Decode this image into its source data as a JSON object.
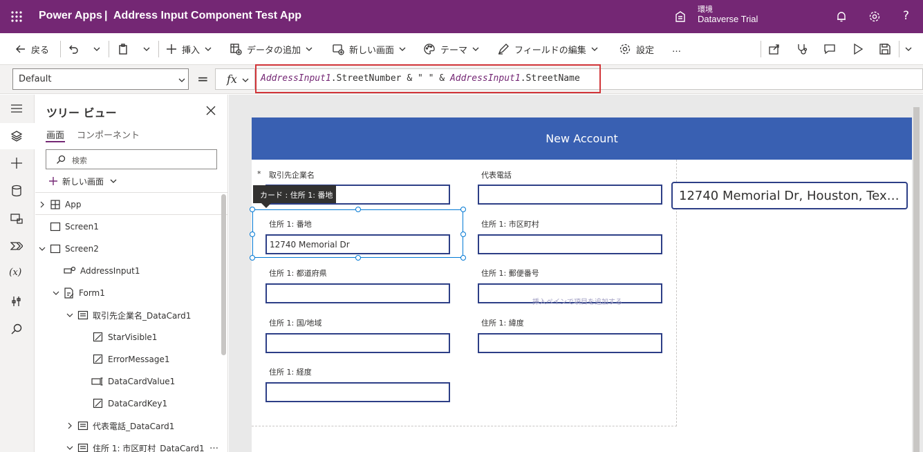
{
  "app": {
    "brand": "Power Apps",
    "separator": "|",
    "title": "Address Input Component Test App",
    "environment_label": "環境",
    "environment_name": "Dataverse Trial",
    "help": "?"
  },
  "commands": {
    "back": "戻る",
    "insert": "挿入",
    "add_data": "データの追加",
    "new_screen": "新しい画面",
    "theme": "テーマ",
    "edit_fields": "フィールドの編集",
    "settings": "設定",
    "more": "…"
  },
  "formula_bar": {
    "property": "Default",
    "equals": "=",
    "fx": "fx",
    "formula_ctl1": "AddressInput1",
    "formula_part1": ".StreetNumber & \" \" & ",
    "formula_ctl2": "AddressInput1",
    "formula_part2": ".StreetName"
  },
  "tree_view": {
    "title": "ツリー ビュー",
    "tabs": [
      "画面",
      "コンポーネント"
    ],
    "search_placeholder": "検索",
    "new_screen": "新しい画面",
    "nodes": [
      {
        "label": "App",
        "icon": "app-icon"
      },
      {
        "label": "Screen1",
        "icon": "screen-icon"
      },
      {
        "label": "Screen2",
        "icon": "screen-icon"
      },
      {
        "label": "AddressInput1",
        "icon": "component-icon"
      },
      {
        "label": "Form1",
        "icon": "form-icon"
      },
      {
        "label": "取引先企業名_DataCard1",
        "icon": "card-icon"
      },
      {
        "label": "StarVisible1",
        "icon": "label-icon"
      },
      {
        "label": "ErrorMessage1",
        "icon": "label-icon"
      },
      {
        "label": "DataCardValue1",
        "icon": "textinput-icon"
      },
      {
        "label": "DataCardKey1",
        "icon": "label-icon"
      },
      {
        "label": "代表電話_DataCard1",
        "icon": "card-icon"
      },
      {
        "label": "住所 1: 市区町村_DataCard1",
        "icon": "card-icon"
      }
    ],
    "more": "…"
  },
  "screen": {
    "header": "New Account",
    "required_star": "*",
    "tooltip": "カード : 住所 1: 番地",
    "watermark": "挿入ペインで項目を追加する",
    "fields": [
      {
        "label": "取引先企業名",
        "value": ""
      },
      {
        "label": "代表電話",
        "value": ""
      },
      {
        "label": "住所 1: 番地",
        "value": "12740 Memorial Dr"
      },
      {
        "label": "住所 1: 市区町村",
        "value": ""
      },
      {
        "label": "住所 1: 都道府県",
        "value": ""
      },
      {
        "label": "住所 1: 郵便番号",
        "value": ""
      },
      {
        "label": "住所 1: 国/地域",
        "value": ""
      },
      {
        "label": "住所 1: 緯度",
        "value": ""
      },
      {
        "label": "住所 1: 経度",
        "value": ""
      }
    ],
    "address_output": "12740 Memorial Dr, Houston, Tex…"
  },
  "colors": {
    "topbar": "#742774",
    "header": "#3960b2",
    "input_border": "#2c3e86",
    "highlight": "#d13438",
    "selection": "#0078d4"
  }
}
